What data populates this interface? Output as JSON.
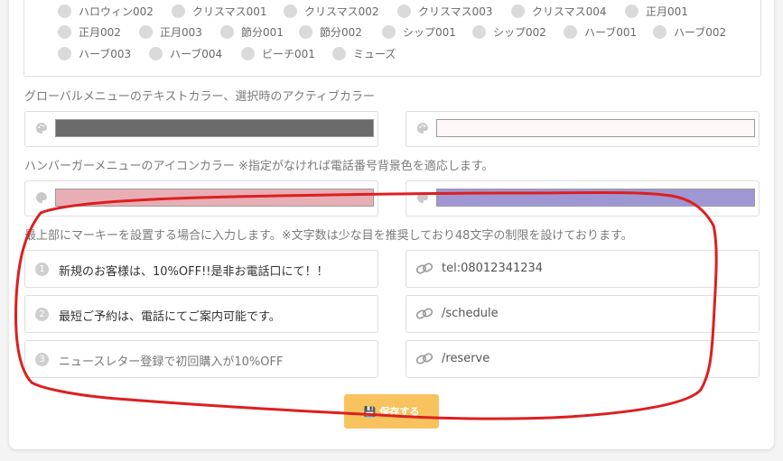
{
  "theme_options": [
    "ハロウィン002",
    "クリスマス001",
    "クリスマス002",
    "クリスマス003",
    "クリスマス004",
    "正月001",
    "正月002",
    "正月003",
    "節分001",
    "節分002",
    "シップ001",
    "シップ002",
    "ハーブ001",
    "ハーブ002",
    "ハーブ003",
    "ハーブ004",
    "ビーチ001",
    "ミューズ"
  ],
  "global_menu": {
    "label": "グローバルメニューのテキストカラー、選択時のアクティブカラー",
    "text_color": "#6b6b6b",
    "active_color": "#fdf7f7"
  },
  "hamburger": {
    "label": "ハンバーガーメニューのアイコンカラー ※指定がなければ電話番号背景色を適応します。",
    "color1": "#e8aeb6",
    "color2": "#9f97d4"
  },
  "marquee": {
    "label": "最上部にマーキーを設置する場合に入力します。※文字数は少な目を推奨しており48文字の制限を設けております。",
    "items": [
      {
        "num": "1",
        "text": "新規のお客様は、10%OFF!!是非お電話口にて！！",
        "link": "tel:08012341234"
      },
      {
        "num": "2",
        "text": "最短ご予約は、電話にてご案内可能です。",
        "link": "/schedule"
      },
      {
        "num": "3",
        "text": "ニュースレター登録で初回購入が10%OFF",
        "link": "/reserve"
      }
    ]
  },
  "save_label": "保存する",
  "accent_colors": {
    "save": "#f8c35e",
    "annotation": "#dd1f1f"
  }
}
